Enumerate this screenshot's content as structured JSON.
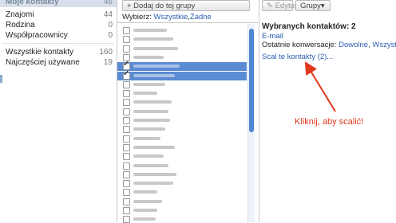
{
  "sidebar": {
    "header": {
      "label": "Moje kontakty",
      "count": "46"
    },
    "groups": [
      {
        "label": "Znajomi",
        "count": "44"
      },
      {
        "label": "Rodzina",
        "count": "0"
      },
      {
        "label": "Współpracownicy",
        "count": "0"
      }
    ],
    "system": [
      {
        "label": "Wszystkie kontakty",
        "count": "160"
      },
      {
        "label": "Najczęściej używane",
        "count": "19"
      }
    ]
  },
  "toolbar": {
    "add_to_group": "+ Dodaj do tej grupy",
    "edit": "✎ Edytuj",
    "groups": "Grupy▾"
  },
  "selection": {
    "label": "Wybierz:",
    "all": "Wszystkie",
    "separator": ",",
    "none": "Żadne"
  },
  "contact_list": {
    "rows": [
      {
        "checked": false,
        "selected": false
      },
      {
        "checked": false,
        "selected": false
      },
      {
        "checked": false,
        "selected": false
      },
      {
        "checked": false,
        "selected": false
      },
      {
        "checked": true,
        "selected": true
      },
      {
        "checked": true,
        "selected": true
      },
      {
        "checked": false,
        "selected": false
      },
      {
        "checked": false,
        "selected": false
      },
      {
        "checked": false,
        "selected": false
      },
      {
        "checked": false,
        "selected": false
      },
      {
        "checked": false,
        "selected": false
      },
      {
        "checked": false,
        "selected": false
      },
      {
        "checked": false,
        "selected": false
      },
      {
        "checked": false,
        "selected": false
      },
      {
        "checked": false,
        "selected": false
      },
      {
        "checked": false,
        "selected": false
      },
      {
        "checked": false,
        "selected": false
      },
      {
        "checked": false,
        "selected": false
      },
      {
        "checked": false,
        "selected": false
      },
      {
        "checked": false,
        "selected": false
      },
      {
        "checked": false,
        "selected": false
      },
      {
        "checked": false,
        "selected": false
      }
    ]
  },
  "details": {
    "title": "Wybranych kontaktów: 2",
    "email_link": "E-mail",
    "recent_label": "Ostatnie konwersacje:",
    "recent_default": "Dowolne",
    "recent_sep": ",",
    "recent_all": "Wszystkie",
    "merge_link": "Scal te kontakty (2)..."
  },
  "annotation": {
    "callout": "Kliknij, aby scalić!",
    "color": "#e0371c"
  },
  "colors": {
    "link": "#2a5db0",
    "selection": "#5b8bd2",
    "scroll_thumb": "#4f86d4"
  }
}
